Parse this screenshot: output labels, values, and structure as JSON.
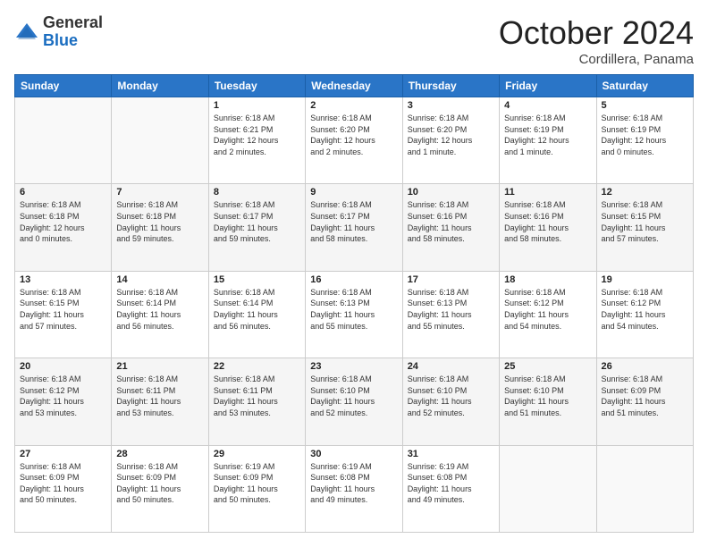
{
  "logo": {
    "general": "General",
    "blue": "Blue"
  },
  "header": {
    "title": "October 2024",
    "location": "Cordillera, Panama"
  },
  "columns": [
    "Sunday",
    "Monday",
    "Tuesday",
    "Wednesday",
    "Thursday",
    "Friday",
    "Saturday"
  ],
  "weeks": [
    [
      {
        "day": "",
        "info": ""
      },
      {
        "day": "",
        "info": ""
      },
      {
        "day": "1",
        "info": "Sunrise: 6:18 AM\nSunset: 6:21 PM\nDaylight: 12 hours\nand 2 minutes."
      },
      {
        "day": "2",
        "info": "Sunrise: 6:18 AM\nSunset: 6:20 PM\nDaylight: 12 hours\nand 2 minutes."
      },
      {
        "day": "3",
        "info": "Sunrise: 6:18 AM\nSunset: 6:20 PM\nDaylight: 12 hours\nand 1 minute."
      },
      {
        "day": "4",
        "info": "Sunrise: 6:18 AM\nSunset: 6:19 PM\nDaylight: 12 hours\nand 1 minute."
      },
      {
        "day": "5",
        "info": "Sunrise: 6:18 AM\nSunset: 6:19 PM\nDaylight: 12 hours\nand 0 minutes."
      }
    ],
    [
      {
        "day": "6",
        "info": "Sunrise: 6:18 AM\nSunset: 6:18 PM\nDaylight: 12 hours\nand 0 minutes."
      },
      {
        "day": "7",
        "info": "Sunrise: 6:18 AM\nSunset: 6:18 PM\nDaylight: 11 hours\nand 59 minutes."
      },
      {
        "day": "8",
        "info": "Sunrise: 6:18 AM\nSunset: 6:17 PM\nDaylight: 11 hours\nand 59 minutes."
      },
      {
        "day": "9",
        "info": "Sunrise: 6:18 AM\nSunset: 6:17 PM\nDaylight: 11 hours\nand 58 minutes."
      },
      {
        "day": "10",
        "info": "Sunrise: 6:18 AM\nSunset: 6:16 PM\nDaylight: 11 hours\nand 58 minutes."
      },
      {
        "day": "11",
        "info": "Sunrise: 6:18 AM\nSunset: 6:16 PM\nDaylight: 11 hours\nand 58 minutes."
      },
      {
        "day": "12",
        "info": "Sunrise: 6:18 AM\nSunset: 6:15 PM\nDaylight: 11 hours\nand 57 minutes."
      }
    ],
    [
      {
        "day": "13",
        "info": "Sunrise: 6:18 AM\nSunset: 6:15 PM\nDaylight: 11 hours\nand 57 minutes."
      },
      {
        "day": "14",
        "info": "Sunrise: 6:18 AM\nSunset: 6:14 PM\nDaylight: 11 hours\nand 56 minutes."
      },
      {
        "day": "15",
        "info": "Sunrise: 6:18 AM\nSunset: 6:14 PM\nDaylight: 11 hours\nand 56 minutes."
      },
      {
        "day": "16",
        "info": "Sunrise: 6:18 AM\nSunset: 6:13 PM\nDaylight: 11 hours\nand 55 minutes."
      },
      {
        "day": "17",
        "info": "Sunrise: 6:18 AM\nSunset: 6:13 PM\nDaylight: 11 hours\nand 55 minutes."
      },
      {
        "day": "18",
        "info": "Sunrise: 6:18 AM\nSunset: 6:12 PM\nDaylight: 11 hours\nand 54 minutes."
      },
      {
        "day": "19",
        "info": "Sunrise: 6:18 AM\nSunset: 6:12 PM\nDaylight: 11 hours\nand 54 minutes."
      }
    ],
    [
      {
        "day": "20",
        "info": "Sunrise: 6:18 AM\nSunset: 6:12 PM\nDaylight: 11 hours\nand 53 minutes."
      },
      {
        "day": "21",
        "info": "Sunrise: 6:18 AM\nSunset: 6:11 PM\nDaylight: 11 hours\nand 53 minutes."
      },
      {
        "day": "22",
        "info": "Sunrise: 6:18 AM\nSunset: 6:11 PM\nDaylight: 11 hours\nand 53 minutes."
      },
      {
        "day": "23",
        "info": "Sunrise: 6:18 AM\nSunset: 6:10 PM\nDaylight: 11 hours\nand 52 minutes."
      },
      {
        "day": "24",
        "info": "Sunrise: 6:18 AM\nSunset: 6:10 PM\nDaylight: 11 hours\nand 52 minutes."
      },
      {
        "day": "25",
        "info": "Sunrise: 6:18 AM\nSunset: 6:10 PM\nDaylight: 11 hours\nand 51 minutes."
      },
      {
        "day": "26",
        "info": "Sunrise: 6:18 AM\nSunset: 6:09 PM\nDaylight: 11 hours\nand 51 minutes."
      }
    ],
    [
      {
        "day": "27",
        "info": "Sunrise: 6:18 AM\nSunset: 6:09 PM\nDaylight: 11 hours\nand 50 minutes."
      },
      {
        "day": "28",
        "info": "Sunrise: 6:18 AM\nSunset: 6:09 PM\nDaylight: 11 hours\nand 50 minutes."
      },
      {
        "day": "29",
        "info": "Sunrise: 6:19 AM\nSunset: 6:09 PM\nDaylight: 11 hours\nand 50 minutes."
      },
      {
        "day": "30",
        "info": "Sunrise: 6:19 AM\nSunset: 6:08 PM\nDaylight: 11 hours\nand 49 minutes."
      },
      {
        "day": "31",
        "info": "Sunrise: 6:19 AM\nSunset: 6:08 PM\nDaylight: 11 hours\nand 49 minutes."
      },
      {
        "day": "",
        "info": ""
      },
      {
        "day": "",
        "info": ""
      }
    ]
  ]
}
